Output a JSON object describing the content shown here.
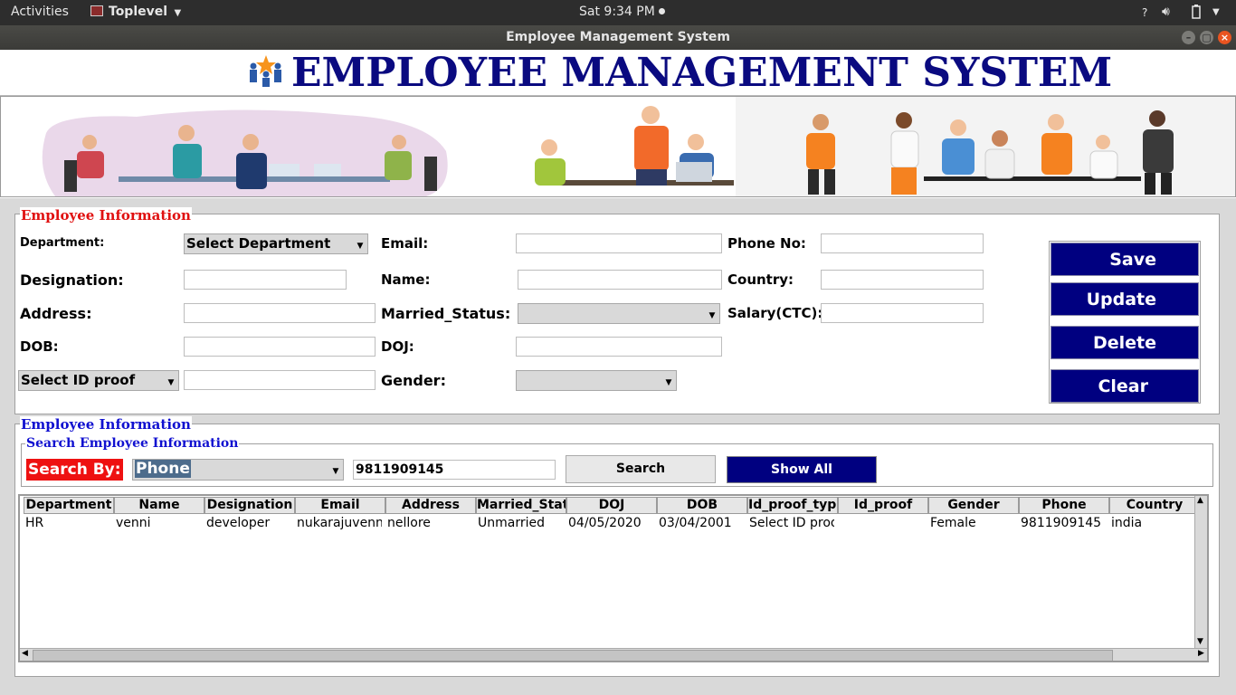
{
  "system_bar": {
    "activities": "Activities",
    "app_menu": "Toplevel",
    "clock": "Sat  9:34 PM",
    "help": "?"
  },
  "window": {
    "title": "Employee Management System"
  },
  "header": {
    "title": "EMPLOYEE MANAGEMENT SYSTEM"
  },
  "form": {
    "legend": "Employee Information",
    "department_label": "Department:",
    "department_value": "Select Department",
    "email_label": "Email:",
    "phone_label": "Phone No:",
    "designation_label": "Designation:",
    "name_label": "Name:",
    "country_label": "Country:",
    "address_label": "Address:",
    "married_label": "Married_Status:",
    "salary_label": "Salary(CTC):",
    "dob_label": "DOB:",
    "doj_label": "DOJ:",
    "idproof_value": "Select ID proof",
    "gender_label": "Gender:"
  },
  "buttons": {
    "save": "Save",
    "update": "Update",
    "delete": "Delete",
    "clear": "Clear"
  },
  "list_section": {
    "legend": "Employee Information",
    "search_legend": "Search Employee Information",
    "search_by_label": "Search By:",
    "search_by_value": "Phone",
    "search_text": "9811909145",
    "search_button": "Search",
    "show_all_button": "Show All"
  },
  "table": {
    "columns": [
      "Department",
      "Name",
      "Designation",
      "Email",
      "Address",
      "Married_Stat",
      "DOJ",
      "DOB",
      "Id_proof_type",
      "Id_proof",
      "Gender",
      "Phone",
      "Country"
    ],
    "rows": [
      [
        "HR",
        "venni",
        "developer",
        "nukarajuvenne",
        "nellore",
        "Unmarried",
        "04/05/2020",
        "03/04/2001",
        "Select ID proof",
        "",
        "Female",
        "9811909145",
        "india"
      ]
    ]
  },
  "colors": {
    "navy": "#000080",
    "title_blue": "#0a0a80",
    "legend_red": "#e01010",
    "legend_blue": "#1010d0",
    "search_by_bg": "#ee1111"
  }
}
